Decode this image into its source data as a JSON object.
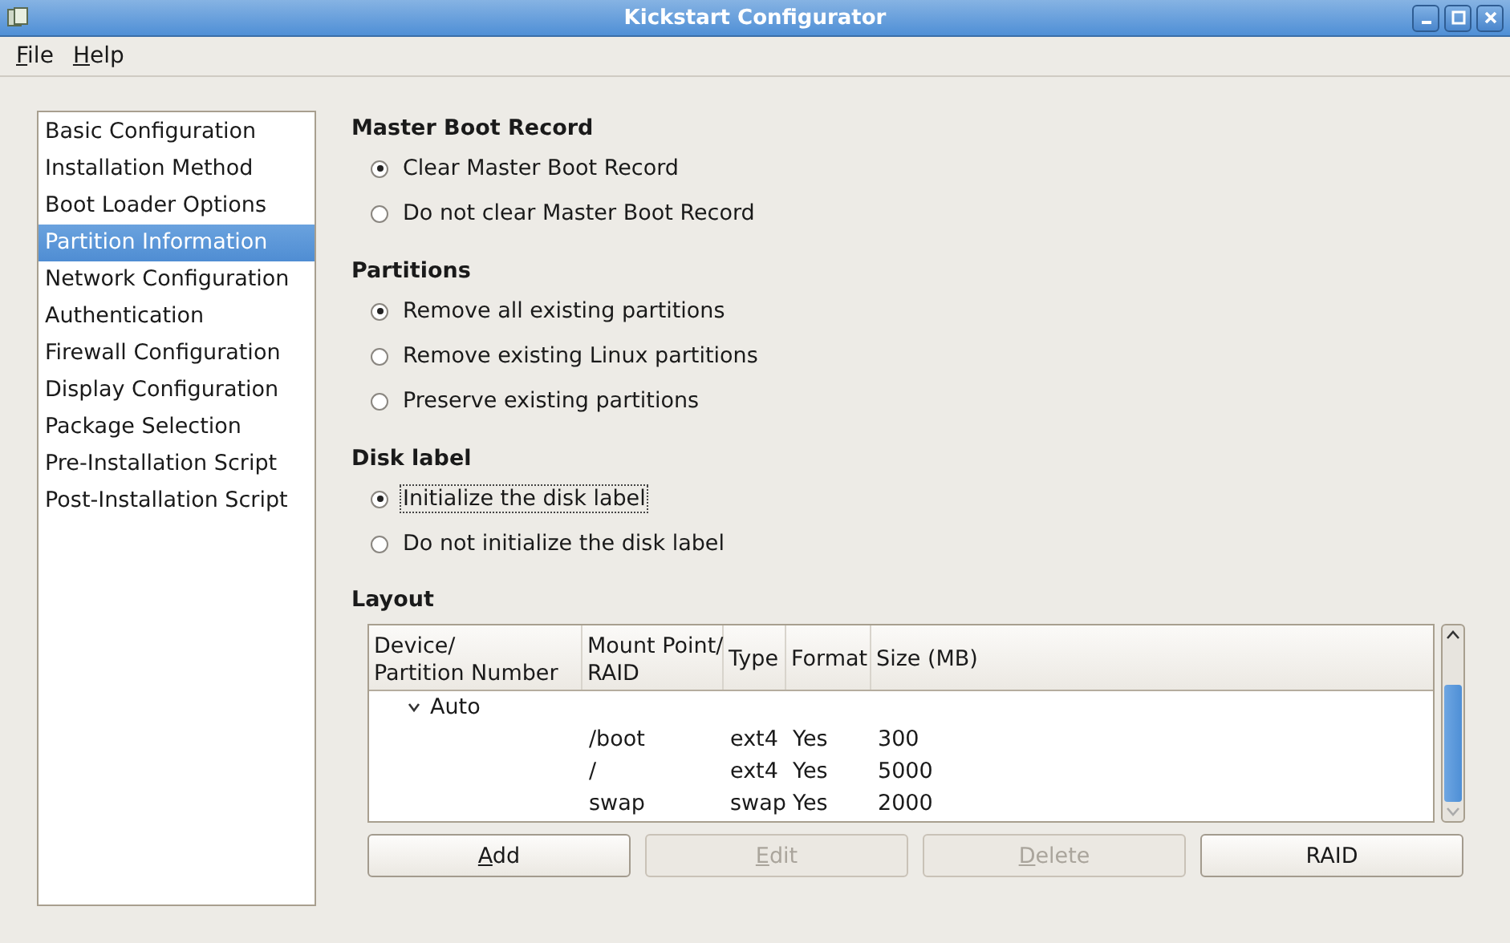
{
  "window": {
    "title": "Kickstart Configurator"
  },
  "menu": [
    {
      "label": "File"
    },
    {
      "label": "Help"
    }
  ],
  "sidebar": {
    "items": [
      {
        "label": "Basic Configuration",
        "selected": false
      },
      {
        "label": "Installation Method",
        "selected": false
      },
      {
        "label": "Boot Loader Options",
        "selected": false
      },
      {
        "label": "Partition Information",
        "selected": true
      },
      {
        "label": "Network Configuration",
        "selected": false
      },
      {
        "label": "Authentication",
        "selected": false
      },
      {
        "label": "Firewall Configuration",
        "selected": false
      },
      {
        "label": "Display Configuration",
        "selected": false
      },
      {
        "label": "Package Selection",
        "selected": false
      },
      {
        "label": "Pre-Installation Script",
        "selected": false
      },
      {
        "label": "Post-Installation Script",
        "selected": false
      }
    ]
  },
  "groups": [
    {
      "title": "Master Boot Record",
      "options": [
        {
          "label": "Clear Master Boot Record",
          "selected": true,
          "focused": false
        },
        {
          "label": "Do not clear Master Boot Record",
          "selected": false,
          "focused": false
        }
      ]
    },
    {
      "title": "Partitions",
      "options": [
        {
          "label": "Remove all existing partitions",
          "selected": true,
          "focused": false
        },
        {
          "label": "Remove existing Linux partitions",
          "selected": false,
          "focused": false
        },
        {
          "label": "Preserve existing partitions",
          "selected": false,
          "focused": false
        }
      ]
    },
    {
      "title": "Disk label",
      "options": [
        {
          "label": "Initialize the disk label",
          "selected": true,
          "focused": true
        },
        {
          "label": "Do not initialize the disk label",
          "selected": false,
          "focused": false
        }
      ]
    }
  ],
  "layout": {
    "title": "Layout",
    "columns": [
      {
        "line1": "Device/",
        "line2": "Partition Number"
      },
      {
        "line1": "Mount Point/",
        "line2": "RAID"
      },
      {
        "line1": "Type"
      },
      {
        "line1": "Format"
      },
      {
        "line1": "Size (MB)"
      }
    ],
    "rows": [
      {
        "device": "Auto",
        "expanded": true,
        "children": [
          {
            "mount_point": "/boot",
            "type": "ext4",
            "format": "Yes",
            "size": "300"
          },
          {
            "mount_point": "/",
            "type": "ext4",
            "format": "Yes",
            "size": "5000"
          },
          {
            "mount_point": "swap",
            "type": "swap",
            "format": "Yes",
            "size": "2000"
          }
        ]
      }
    ],
    "buttons": [
      {
        "label": "Add",
        "mnemonic": true,
        "disabled": false
      },
      {
        "label": "Edit",
        "mnemonic": true,
        "disabled": true
      },
      {
        "label": "Delete",
        "mnemonic": true,
        "disabled": true
      },
      {
        "label": "RAID",
        "mnemonic": false,
        "disabled": false
      }
    ]
  }
}
